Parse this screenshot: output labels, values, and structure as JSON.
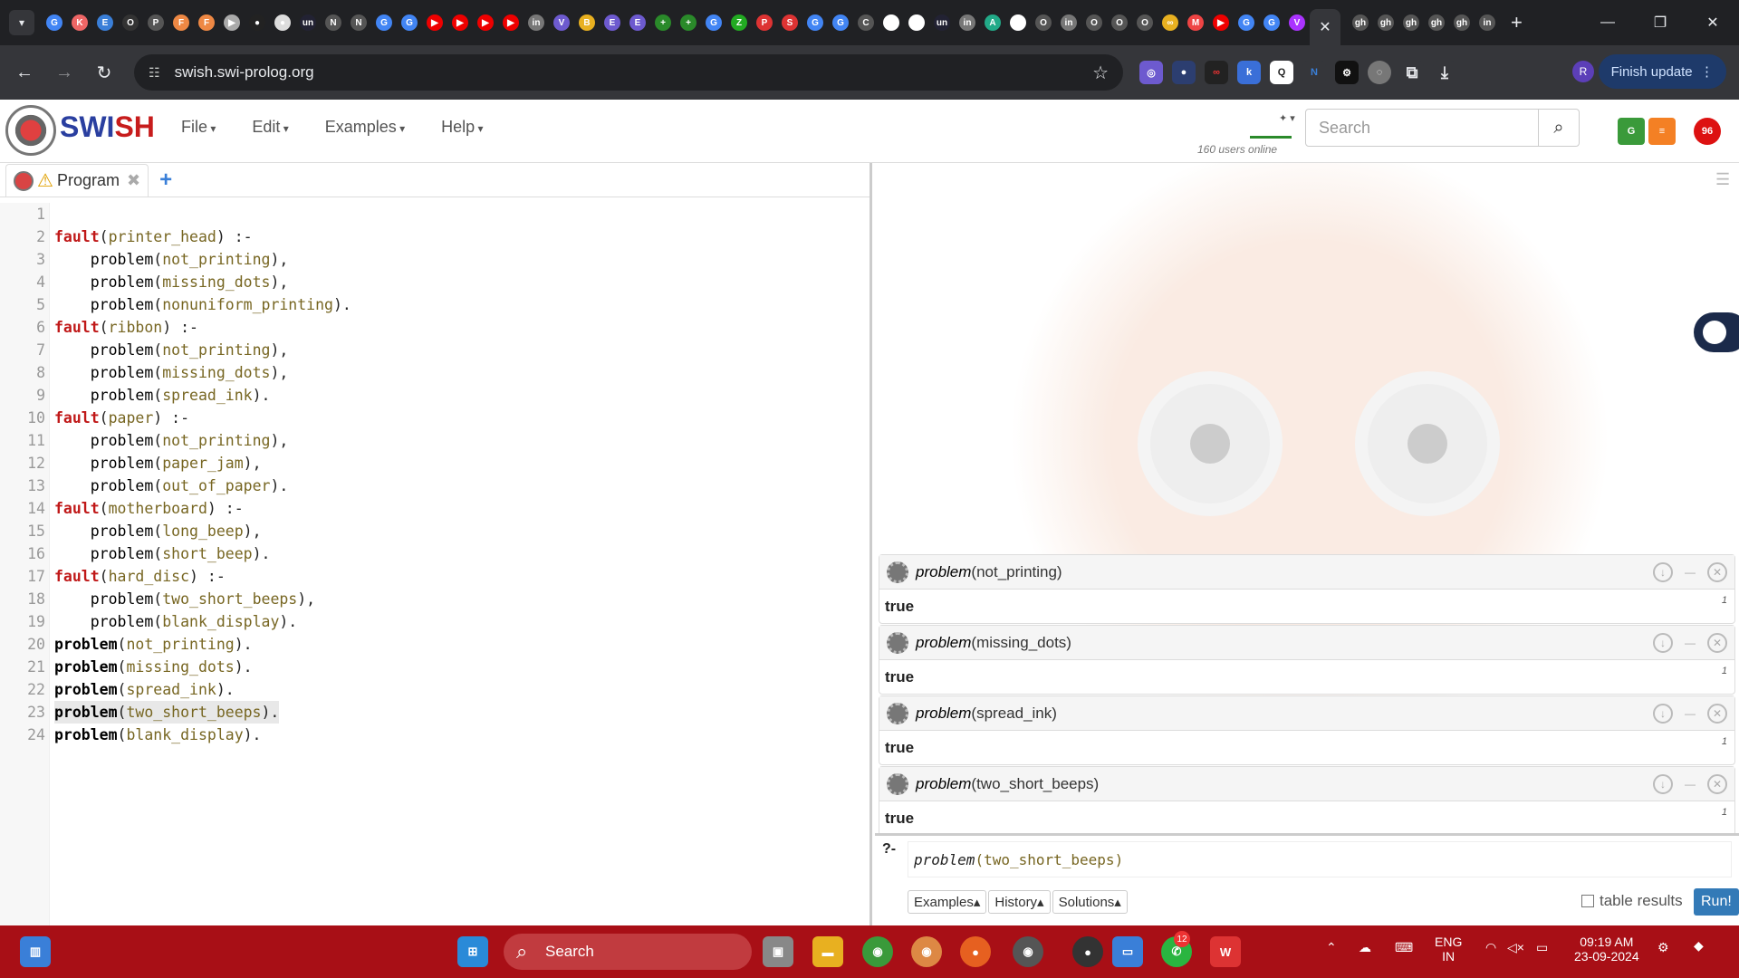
{
  "browser": {
    "url": "swish.swi-prolog.org",
    "finish_update": "Finish update",
    "profile_initial": "R",
    "pinned_favicons": [
      "G",
      "K",
      "E",
      "O",
      "P",
      "F",
      "F",
      "▶",
      "●",
      "●",
      "un",
      "N",
      "N",
      "G",
      "G",
      "▶",
      "▶",
      "▶",
      "▶",
      "in",
      "V",
      "B",
      "E",
      "E",
      "+",
      "+",
      "G",
      "Z",
      "P",
      "S",
      "G",
      "G",
      "C",
      "W",
      "W",
      "un",
      "in",
      "A",
      "W",
      "O",
      "in",
      "O",
      "O",
      "O",
      "∞",
      "M",
      "▶",
      "G",
      "G",
      "V"
    ],
    "tail_favicons": [
      "gh",
      "gh",
      "gh",
      "gh",
      "gh",
      "in"
    ]
  },
  "swish": {
    "brand_left": "SWI",
    "brand_right": "SH",
    "menus": [
      "File",
      "Edit",
      "Examples",
      "Help"
    ],
    "users_online": "160 users online",
    "search_placeholder": "Search",
    "notification_count": "96"
  },
  "editor": {
    "tab_label": "Program",
    "lines": [
      {
        "n": "1",
        "t": ""
      },
      {
        "n": "2",
        "head": "fault",
        "arg": "printer_head",
        "tail": ") :-"
      },
      {
        "n": "3",
        "indent": "    ",
        "fn": "problem",
        "arg": "not_printing",
        "tail": "),"
      },
      {
        "n": "4",
        "indent": "    ",
        "fn": "problem",
        "arg": "missing_dots",
        "tail": "),"
      },
      {
        "n": "5",
        "indent": "    ",
        "fn": "problem",
        "arg": "nonuniform_printing",
        "tail": ")."
      },
      {
        "n": "6",
        "head": "fault",
        "arg": "ribbon",
        "tail": ") :-"
      },
      {
        "n": "7",
        "indent": "    ",
        "fn": "problem",
        "arg": "not_printing",
        "tail": "),"
      },
      {
        "n": "8",
        "indent": "    ",
        "fn": "problem",
        "arg": "missing_dots",
        "tail": "),"
      },
      {
        "n": "9",
        "indent": "    ",
        "fn": "problem",
        "arg": "spread_ink",
        "tail": ")."
      },
      {
        "n": "10",
        "head": "fault",
        "arg": "paper",
        "tail": ") :-"
      },
      {
        "n": "11",
        "indent": "    ",
        "fn": "problem",
        "arg": "not_printing",
        "tail": "),"
      },
      {
        "n": "12",
        "indent": "    ",
        "fn": "problem",
        "arg": "paper_jam",
        "tail": "),"
      },
      {
        "n": "13",
        "indent": "    ",
        "fn": "problem",
        "arg": "out_of_paper",
        "tail": ")."
      },
      {
        "n": "14",
        "head": "fault",
        "arg": "motherboard",
        "tail": ") :-"
      },
      {
        "n": "15",
        "indent": "    ",
        "fn": "problem",
        "arg": "long_beep",
        "tail": "),"
      },
      {
        "n": "16",
        "indent": "    ",
        "fn": "problem",
        "arg": "short_beep",
        "tail": ")."
      },
      {
        "n": "17",
        "head": "fault",
        "arg": "hard_disc",
        "tail": ") :-"
      },
      {
        "n": "18",
        "indent": "    ",
        "fn": "problem",
        "arg": "two_short_beeps",
        "tail": "),"
      },
      {
        "n": "19",
        "indent": "    ",
        "fn": "problem",
        "arg": "blank_display",
        "tail": ")."
      },
      {
        "n": "20",
        "bold": "problem",
        "arg": "not_printing",
        "tail": ")."
      },
      {
        "n": "21",
        "bold": "problem",
        "arg": "missing_dots",
        "tail": ")."
      },
      {
        "n": "22",
        "bold": "problem",
        "arg": "spread_ink",
        "tail": ")."
      },
      {
        "n": "23",
        "bold": "problem",
        "arg": "two_short_beeps",
        "tail": ").",
        "hl": true
      },
      {
        "n": "24",
        "bold": "problem",
        "arg": "blank_display",
        "tail": ")."
      }
    ]
  },
  "results": [
    {
      "name": "problem",
      "arg": "(not_printing)",
      "answer": "true",
      "count": "1"
    },
    {
      "name": "problem",
      "arg": "(missing_dots)",
      "answer": "true",
      "count": "1"
    },
    {
      "name": "problem",
      "arg": "(spread_ink)",
      "answer": "true",
      "count": "1"
    },
    {
      "name": "problem",
      "arg": "(two_short_beeps)",
      "answer": "true",
      "count": "1"
    }
  ],
  "query": {
    "prompt": "?-",
    "name": "problem",
    "arg": "(two_short_beeps)",
    "buttons": [
      "Examples▴",
      "History▴",
      "Solutions▴"
    ],
    "table_results": "table results",
    "run": "Run!"
  },
  "taskbar": {
    "search": "Search",
    "lang": "ENG",
    "region": "IN",
    "time": "09:19 AM",
    "date": "23-09-2024",
    "whatsapp_badge": "12"
  }
}
